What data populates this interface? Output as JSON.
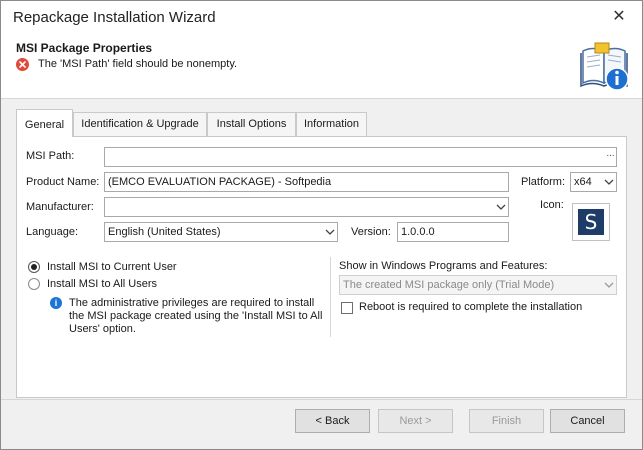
{
  "window": {
    "title": "Repackage Installation Wizard",
    "close_glyph": "✕"
  },
  "header": {
    "title": "MSI Package Properties",
    "error_message": "The 'MSI Path' field should be nonempty.",
    "error_icon": "error-circle-icon",
    "corner_icon": "book-info-icon"
  },
  "tabs": [
    {
      "label": "General",
      "active": true
    },
    {
      "label": "Identification & Upgrade",
      "active": false
    },
    {
      "label": "Install Options",
      "active": false
    },
    {
      "label": "Information",
      "active": false
    }
  ],
  "general": {
    "msi_path": {
      "label": "MSI Path:",
      "value": "",
      "browse_glyph": "..."
    },
    "product_name": {
      "label": "Product Name:",
      "value": "(EMCO EVALUATION PACKAGE) - Softpedia"
    },
    "platform": {
      "label": "Platform:",
      "value": "x64"
    },
    "manufacturer": {
      "label": "Manufacturer:",
      "value": ""
    },
    "icon": {
      "label": "Icon:",
      "glyph": "S",
      "color": "#1f3b68"
    },
    "language": {
      "label": "Language:",
      "value": "English (United States)"
    },
    "version": {
      "label": "Version:",
      "value": "1.0.0.0"
    },
    "install_scope": {
      "current_user": {
        "label": "Install MSI to Current User",
        "checked": true
      },
      "all_users": {
        "label": "Install MSI to All Users",
        "checked": false
      },
      "info_lines": [
        "The administrative privileges are required to install",
        "the MSI package created using the 'Install MSI to All",
        "Users' option."
      ]
    },
    "programs_features": {
      "label": "Show in Windows Programs and Features:",
      "value": "The created MSI package only (Trial Mode)"
    },
    "reboot": {
      "label": "Reboot is required to complete the installation",
      "checked": false
    }
  },
  "buttons": {
    "back": "< Back",
    "next": "Next >",
    "finish": "Finish",
    "cancel": "Cancel"
  }
}
